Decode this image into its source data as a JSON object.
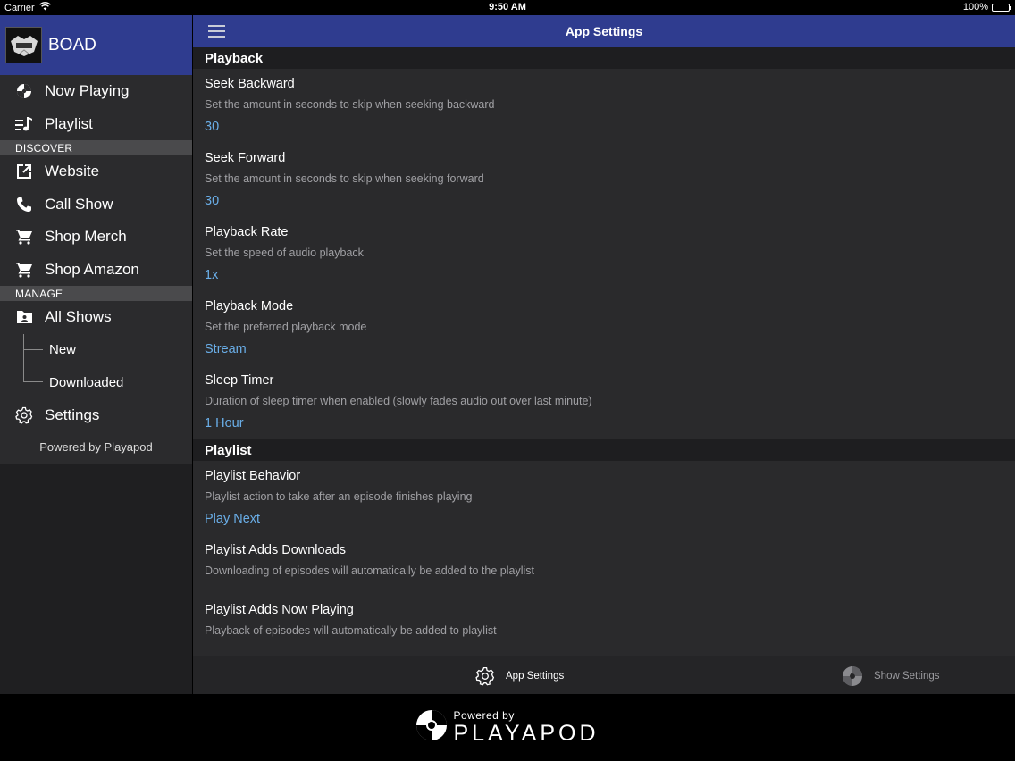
{
  "status_bar": {
    "carrier": "Carrier",
    "time": "9:50 AM",
    "battery": "100%"
  },
  "sidebar": {
    "brand": "BOAD",
    "items": [
      {
        "label": "Now Playing",
        "icon": "disc-icon"
      },
      {
        "label": "Playlist",
        "icon": "playlist-icon"
      }
    ],
    "discover_label": "DISCOVER",
    "discover_items": [
      {
        "label": "Website",
        "icon": "external-link-icon"
      },
      {
        "label": "Call Show",
        "icon": "phone-icon"
      },
      {
        "label": "Shop Merch",
        "icon": "cart-icon"
      },
      {
        "label": "Shop Amazon",
        "icon": "cart-icon"
      }
    ],
    "manage_label": "MANAGE",
    "manage_items": [
      {
        "label": "All Shows",
        "icon": "folder-icon"
      }
    ],
    "sub_items": [
      {
        "label": "New"
      },
      {
        "label": "Downloaded"
      }
    ],
    "settings_label": "Settings",
    "powered": "Powered by Playapod"
  },
  "header": {
    "title": "App Settings"
  },
  "sections": {
    "playback": {
      "title": "Playback",
      "settings": [
        {
          "name": "Seek Backward",
          "desc": "Set the amount in seconds to skip when seeking backward",
          "value": "30"
        },
        {
          "name": "Seek Forward",
          "desc": "Set the amount in seconds to skip when seeking forward",
          "value": "30"
        },
        {
          "name": "Playback Rate",
          "desc": "Set the speed of audio playback",
          "value": "1x"
        },
        {
          "name": "Playback Mode",
          "desc": "Set the preferred playback mode",
          "value": "Stream"
        },
        {
          "name": "Sleep Timer",
          "desc": "Duration of sleep timer when enabled (slowly fades audio out over last minute)",
          "value": "1 Hour"
        }
      ]
    },
    "playlist": {
      "title": "Playlist",
      "settings": [
        {
          "name": "Playlist Behavior",
          "desc": "Playlist action to take after an episode finishes playing",
          "value": "Play Next"
        },
        {
          "name": "Playlist Adds Downloads",
          "desc": "Downloading of episodes will automatically be added to the playlist"
        },
        {
          "name": "Playlist Adds Now Playing",
          "desc": "Playback of episodes will automatically be added to playlist"
        }
      ]
    }
  },
  "tabs": {
    "app_settings": "App Settings",
    "show_settings": "Show Settings"
  },
  "footer": {
    "powered_by": "Powered by",
    "brand": "PLAYAPOD"
  },
  "colors": {
    "accent_bar": "#2f3c8f",
    "value_blue": "#6aaee8"
  }
}
